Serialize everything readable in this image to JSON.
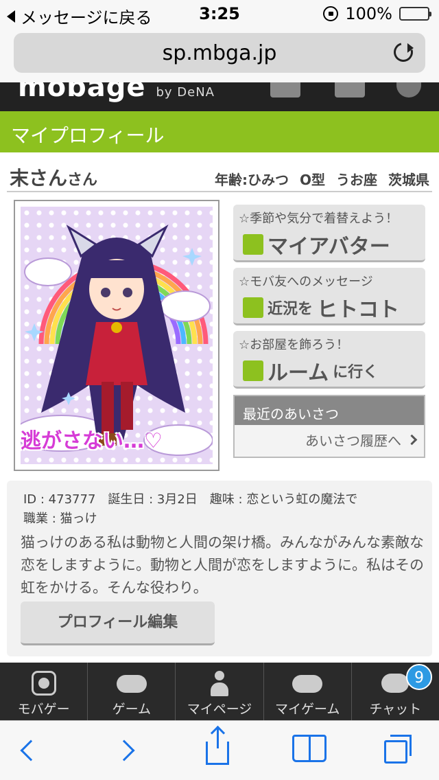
{
  "status_bar": {
    "back_label": "メッセージに戻る",
    "time": "3:25",
    "battery": "100%"
  },
  "browser": {
    "url": "sp.mbga.jp"
  },
  "header": {
    "logo": "mobage",
    "logo_sub": "by DeNA"
  },
  "page": {
    "title": "マイプロフィール"
  },
  "profile": {
    "name": "末さん",
    "honorific": "さん",
    "age": "年齢:ひみつ",
    "blood": "O型",
    "sign": "うお座",
    "prefecture": "茨城県",
    "avatar_caption": "逃がさない…♡",
    "id": "ID : 473777",
    "birthday": "誕生日 : 3月2日",
    "hobby": "趣味 : 恋という虹の魔法で",
    "job": "職業 : 猫っけ",
    "bio": "猫っけのある私は動物と人間の架け橋。みんながみんな素敵な恋をしますように。動物と人間が恋をしますように。私はその虹をかける。そんな役わり。",
    "edit_label": "プロフィール編集"
  },
  "actions": [
    {
      "small": "☆季節や気分で着替えよう！",
      "big": "マイアバター",
      "mid": ""
    },
    {
      "small": "☆モバ友へのメッセージ",
      "big_pre": "近況を",
      "big": "ヒトコト"
    },
    {
      "small": "☆お部屋を飾ろう！",
      "big": "ルーム",
      "mid": "に行く"
    }
  ],
  "greetings": {
    "header": "最近のあいさつ",
    "link": "あいさつ履歴へ"
  },
  "bottom_nav": [
    {
      "label": "モバゲー",
      "icon": "mobage-icon"
    },
    {
      "label": "ゲーム",
      "icon": "gamepad-icon"
    },
    {
      "label": "マイページ",
      "icon": "person-icon"
    },
    {
      "label": "マイゲーム",
      "icon": "gamepad-person-icon"
    },
    {
      "label": "チャット",
      "icon": "chat-icon",
      "badge": "9"
    }
  ],
  "colors": {
    "accent_green": "#8dc11f",
    "badge_blue": "#2d9ae3",
    "safari_blue": "#1a73e8"
  }
}
